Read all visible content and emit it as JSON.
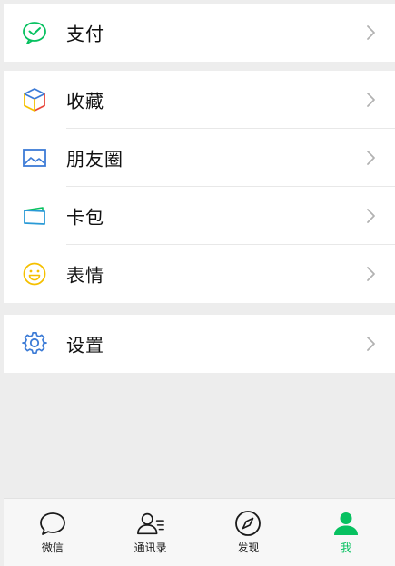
{
  "menu": {
    "pay": {
      "label": "支付",
      "icon": "wechat-pay-icon",
      "color": "#07c160"
    },
    "favorites": {
      "label": "收藏",
      "icon": "cube-icon"
    },
    "moments": {
      "label": "朋友圈",
      "icon": "photo-icon",
      "color": "#3c7bd6"
    },
    "cards": {
      "label": "卡包",
      "icon": "card-wallet-icon",
      "color": "#2a9ad6"
    },
    "stickers": {
      "label": "表情",
      "icon": "smiley-icon",
      "color": "#f5c000"
    },
    "settings": {
      "label": "设置",
      "icon": "gear-icon",
      "color": "#3c7bd6"
    }
  },
  "tabbar": {
    "tabs": [
      {
        "label": "微信",
        "icon": "chat-bubble-icon",
        "active": false
      },
      {
        "label": "通讯录",
        "icon": "contacts-icon",
        "active": false
      },
      {
        "label": "发现",
        "icon": "compass-icon",
        "active": false
      },
      {
        "label": "我",
        "icon": "person-icon",
        "active": true
      }
    ],
    "active_color": "#07c160"
  }
}
